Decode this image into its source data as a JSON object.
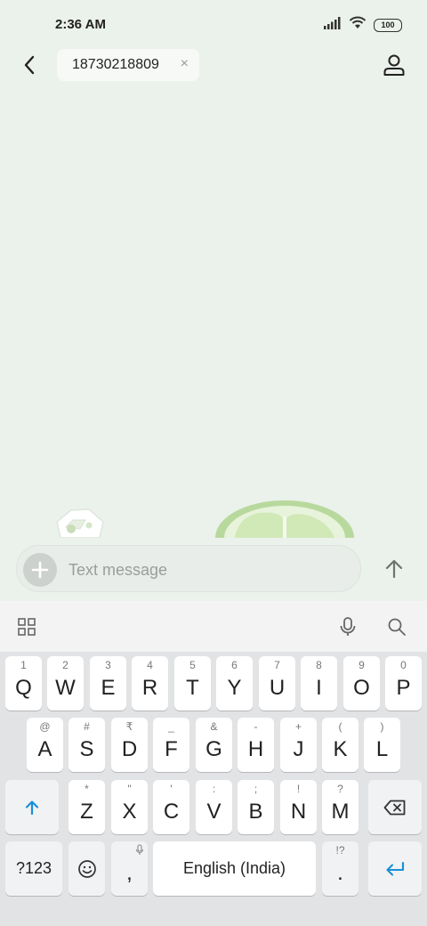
{
  "status_bar": {
    "time": "2:36 AM",
    "battery": "100",
    "icons": [
      "signal-icon",
      "wifi-icon",
      "battery-icon"
    ]
  },
  "header": {
    "back_icon": "back-arrow-icon",
    "recipient": "18730218809",
    "chip_close": "×",
    "profile_icon": "person-icon"
  },
  "composer": {
    "placeholder": "Text message",
    "value": "",
    "add_icon": "plus-icon",
    "send_icon": "send-arrow-icon"
  },
  "keyboard_toolbar": {
    "icons": [
      "apps-grid-icon",
      "microphone-icon",
      "search-icon"
    ]
  },
  "keyboard": {
    "row1": [
      {
        "hint": "1",
        "label": "Q"
      },
      {
        "hint": "2",
        "label": "W"
      },
      {
        "hint": "3",
        "label": "E"
      },
      {
        "hint": "4",
        "label": "R"
      },
      {
        "hint": "5",
        "label": "T"
      },
      {
        "hint": "6",
        "label": "Y"
      },
      {
        "hint": "7",
        "label": "U"
      },
      {
        "hint": "8",
        "label": "I"
      },
      {
        "hint": "9",
        "label": "O"
      },
      {
        "hint": "0",
        "label": "P"
      }
    ],
    "row2": [
      {
        "hint": "@",
        "label": "A"
      },
      {
        "hint": "#",
        "label": "S"
      },
      {
        "hint": "₹",
        "label": "D"
      },
      {
        "hint": "_",
        "label": "F"
      },
      {
        "hint": "&",
        "label": "G"
      },
      {
        "hint": "-",
        "label": "H"
      },
      {
        "hint": "+",
        "label": "J"
      },
      {
        "hint": "(",
        "label": "K"
      },
      {
        "hint": ")",
        "label": "L"
      }
    ],
    "row3": [
      {
        "hint": "*",
        "label": "Z"
      },
      {
        "hint": "\"",
        "label": "X"
      },
      {
        "hint": "'",
        "label": "C"
      },
      {
        "hint": ":",
        "label": "V"
      },
      {
        "hint": ";",
        "label": "B"
      },
      {
        "hint": "!",
        "label": "N"
      },
      {
        "hint": "?",
        "label": "M"
      }
    ],
    "symbols_label": "?123",
    "comma_label": ",",
    "space_label": "English (India)",
    "period_hint": "!?",
    "period_label": ".",
    "accent_color": "#1a8fd8"
  }
}
